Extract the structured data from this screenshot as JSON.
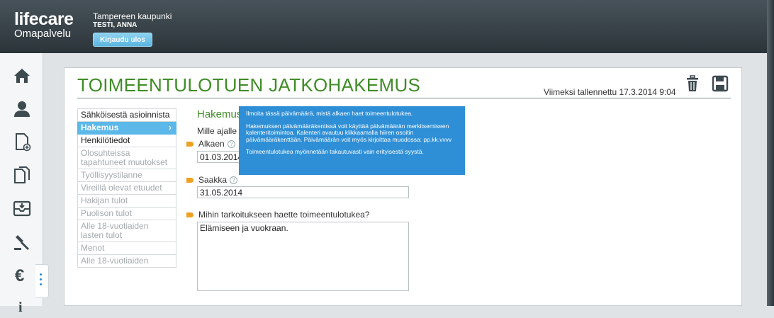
{
  "header": {
    "brand": "lifecare",
    "brand_sub": "Omapalvelu",
    "organization": "Tampereen kaupunki",
    "user": "TESTI, ANNA",
    "logout_label": "Kirjaudu ulos"
  },
  "sidebar": {
    "icons": [
      "home-icon",
      "person-icon",
      "new-document-icon",
      "documents-icon",
      "inbox-icon",
      "gavel-icon",
      "euro-icon",
      "info-icon"
    ]
  },
  "page": {
    "title": "TOIMEENTULOTUEN JATKOHAKEMUS",
    "last_saved": "Viimeksi tallennettu 17.3.2014 9:04"
  },
  "nav": {
    "items": [
      {
        "label": "Sähköisestä asioinnista"
      },
      {
        "label": "Hakemus"
      },
      {
        "label": "Henkilötiedot"
      },
      {
        "label": "Olosuhteissa tapahtuneet muutokset"
      },
      {
        "label": "Työllisyystilanne"
      },
      {
        "label": "Vireillä olevat etuudet"
      },
      {
        "label": "Hakijan tulot"
      },
      {
        "label": "Puolison tulot"
      },
      {
        "label": "Alle 18-vuotiaiden lasten tulot"
      },
      {
        "label": "Menot"
      },
      {
        "label": "Alle 18-vuotiaiden"
      }
    ]
  },
  "form": {
    "section_title": "Hakemus",
    "question": "Mille ajalle haet",
    "start_label": "Alkaen",
    "start_value": "01.03.2014",
    "end_label": "Saakka",
    "end_value": "31.05.2014",
    "purpose_label": "Mihin tarkoitukseen haette toimeentulotukea?",
    "purpose_value": "Elämiseen ja vuokraan."
  },
  "tooltip": {
    "p1": "Ilmoita tässä päivämäärä, mistä alkaen haet toimeentulotukea.",
    "p2": "Hakemuksen päivämääräkentissä voit käyttää päivämäärän merkitsemiseen kalenteritoimintoa. Kalenteri avautuu klikkaamalla hiiren osoitin päivämääräkenttään. Päivämäärän voit myös kirjoittaa muodossa: pp.kk.vvvv",
    "p3": "Toimeentulotukea myönnetään takautuvasti vain erityisestä syystä."
  },
  "colors": {
    "title_green": "#3f8d27",
    "accent_blue": "#5bb8e8",
    "tooltip_blue": "#2f8fd6",
    "marker_orange": "#f0a020"
  }
}
